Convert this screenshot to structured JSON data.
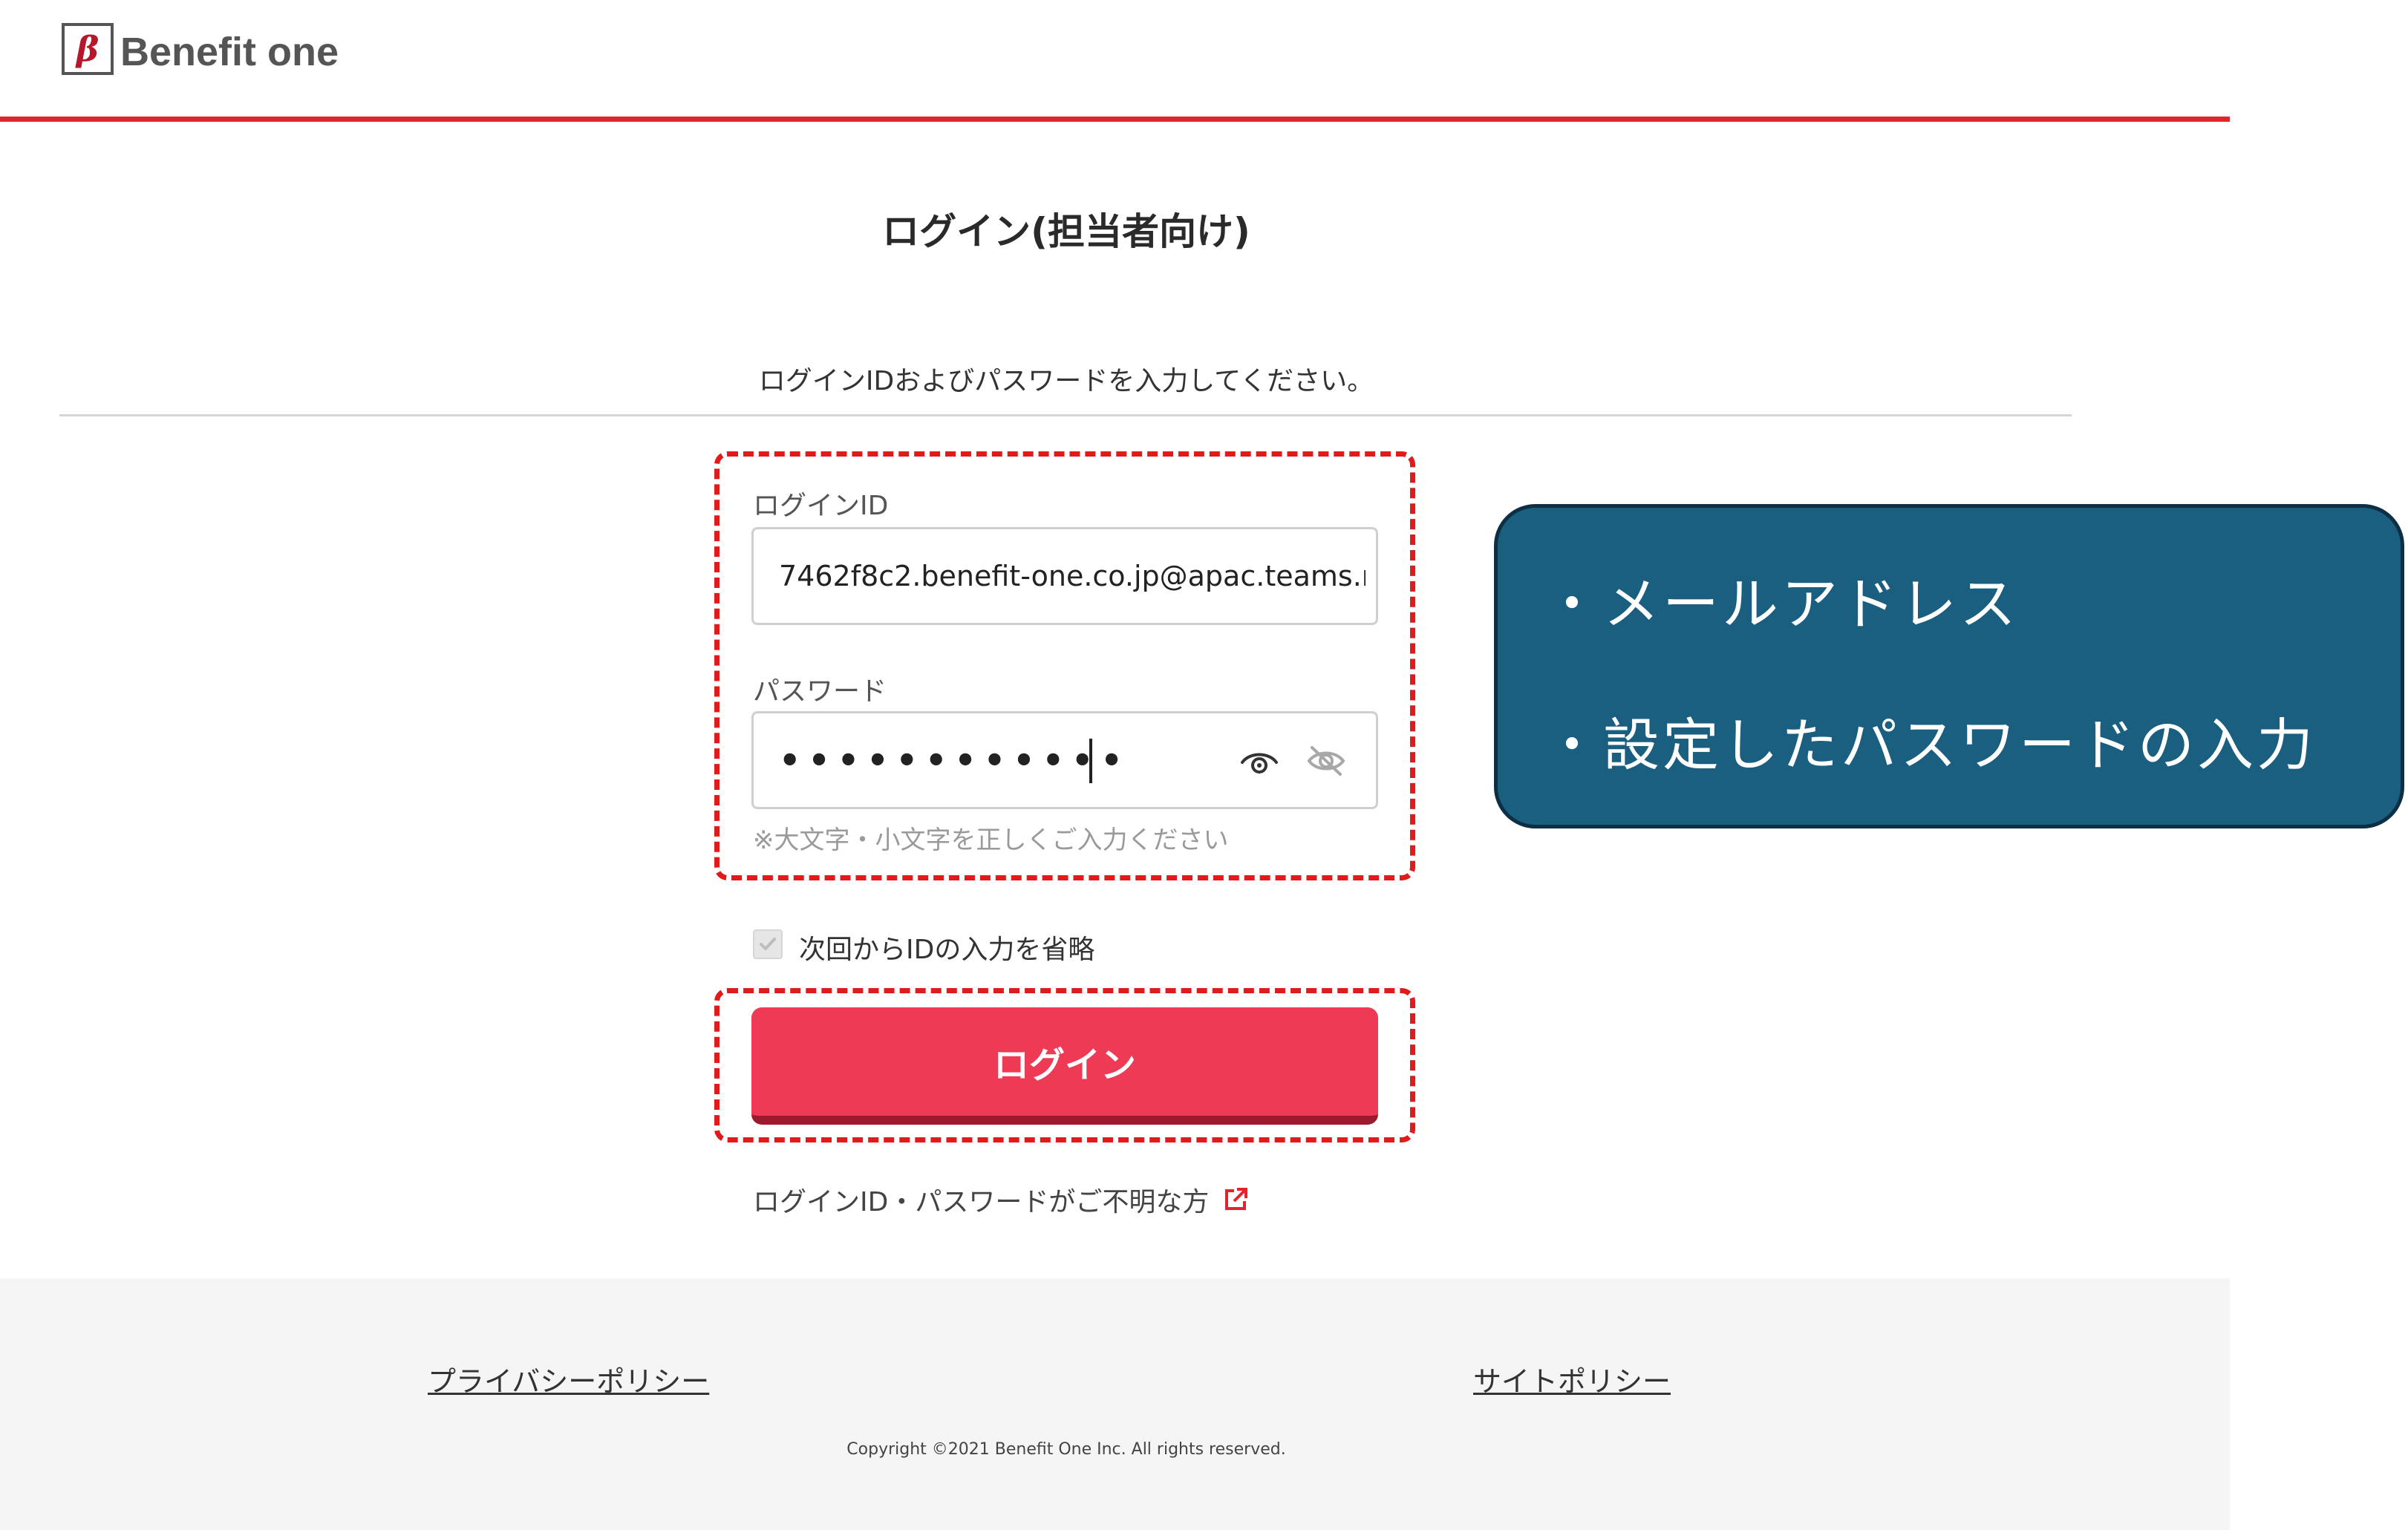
{
  "header": {
    "logo_mark": "β",
    "logo_text": "Benefit one"
  },
  "page": {
    "title": "ログイン(担当者向け)",
    "instruction": "ログインIDおよびパスワードを入力してください。"
  },
  "form": {
    "login_id_label": "ログインID",
    "login_id_value": "7462f8c2.benefit-one.co.jp@apac.teams.m",
    "password_label": "パスワード",
    "password_masked": "••••••••••••",
    "password_hint": "※大文字・小文字を正しくご入力ください",
    "remember_label": "次回からIDの入力を省略",
    "remember_checked": true,
    "login_button": "ログイン",
    "help_link": "ログインID・パスワードがご不明な方"
  },
  "footer": {
    "privacy_link": "プライバシーポリシー",
    "site_policy_link": "サイトポリシー",
    "copyright": "Copyright ©2021 Benefit One Inc. All rights reserved."
  },
  "callout": {
    "line1": "・メールアドレス",
    "line2": "・設定したパスワードの入力"
  },
  "colors": {
    "accent_red": "#e0262c",
    "button": "#ee3a55",
    "callout_bg": "#1a5e80",
    "annotation_dash": "#e01b1b"
  },
  "icons": [
    "show-password-icon",
    "hide-password-icon",
    "external-link-icon",
    "checkmark-icon"
  ]
}
